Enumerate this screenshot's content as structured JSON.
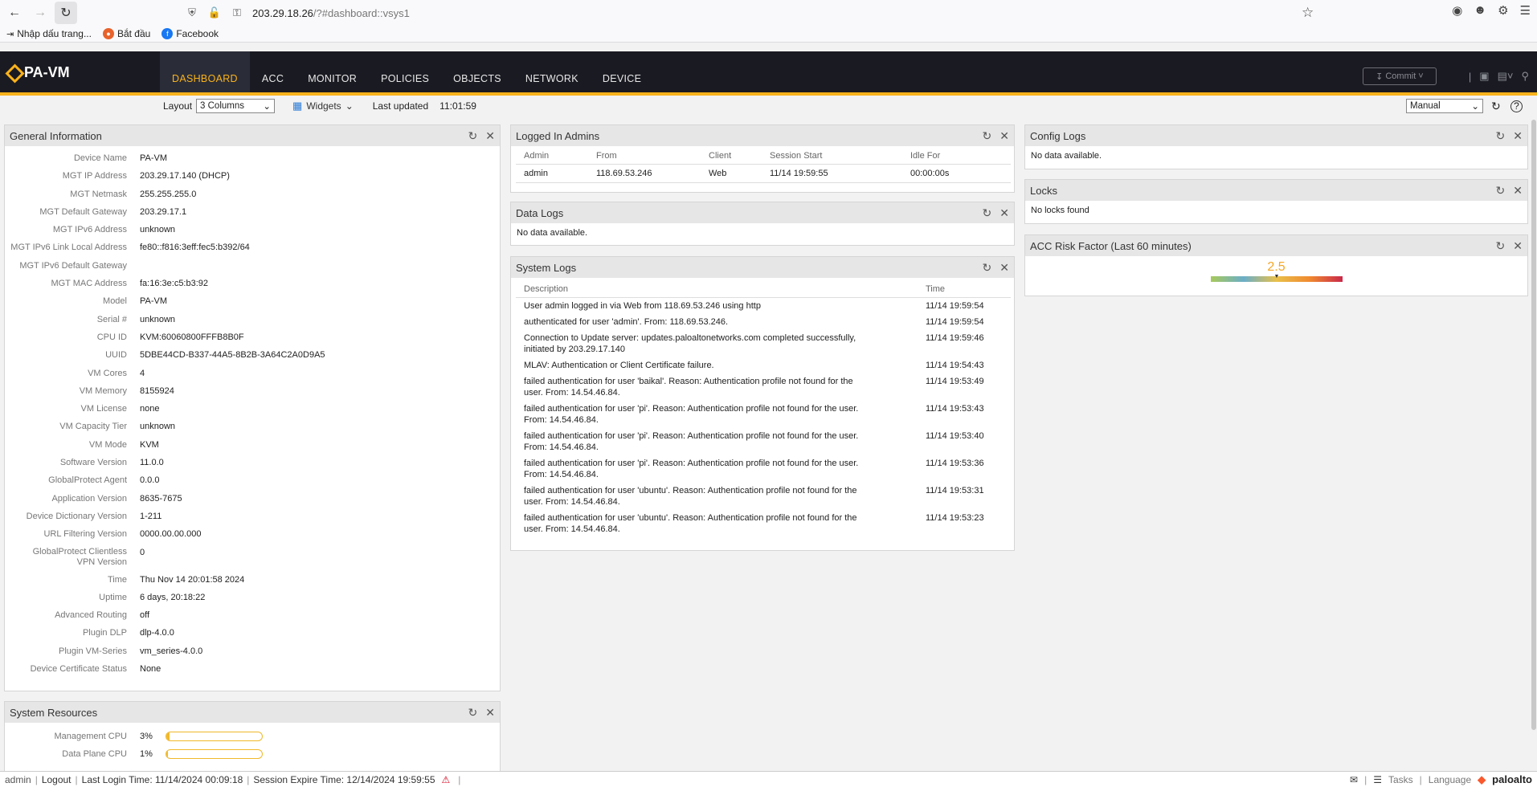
{
  "browser": {
    "url_host": "203.29.18.26",
    "url_path": "/?#dashboard::vsys1",
    "bookmarks": [
      {
        "label": "Nhập dấu trang..."
      },
      {
        "label": "Bắt đầu"
      },
      {
        "label": "Facebook"
      }
    ]
  },
  "app": {
    "logo": "PA-VM",
    "tabs": [
      "DASHBOARD",
      "ACC",
      "MONITOR",
      "POLICIES",
      "OBJECTS",
      "NETWORK",
      "DEVICE"
    ],
    "active_tab": "DASHBOARD",
    "commit_label": "Commit"
  },
  "toolbar": {
    "layout_label": "Layout",
    "layout_value": "3 Columns",
    "widgets_label": "Widgets",
    "last_updated_label": "Last updated",
    "last_updated_value": "11:01:59",
    "refresh_mode": "Manual"
  },
  "general_info": {
    "title": "General Information",
    "rows": [
      {
        "label": "Device Name",
        "value": "PA-VM"
      },
      {
        "label": "MGT IP Address",
        "value": "203.29.17.140 (DHCP)"
      },
      {
        "label": "MGT Netmask",
        "value": "255.255.255.0"
      },
      {
        "label": "MGT Default Gateway",
        "value": "203.29.17.1"
      },
      {
        "label": "MGT IPv6 Address",
        "value": "unknown"
      },
      {
        "label": "MGT IPv6 Link Local Address",
        "value": "fe80::f816:3eff:fec5:b392/64"
      },
      {
        "label": "MGT IPv6 Default Gateway",
        "value": ""
      },
      {
        "label": "MGT MAC Address",
        "value": "fa:16:3e:c5:b3:92"
      },
      {
        "label": "Model",
        "value": "PA-VM"
      },
      {
        "label": "Serial #",
        "value": "unknown"
      },
      {
        "label": "CPU ID",
        "value": "KVM:60060800FFFB8B0F"
      },
      {
        "label": "UUID",
        "value": "5DBE44CD-B337-44A5-8B2B-3A64C2A0D9A5"
      },
      {
        "label": "VM Cores",
        "value": "4"
      },
      {
        "label": "VM Memory",
        "value": "8155924"
      },
      {
        "label": "VM License",
        "value": "none"
      },
      {
        "label": "VM Capacity Tier",
        "value": "unknown"
      },
      {
        "label": "VM Mode",
        "value": "KVM"
      },
      {
        "label": "Software Version",
        "value": "11.0.0"
      },
      {
        "label": "GlobalProtect Agent",
        "value": "0.0.0"
      },
      {
        "label": "Application Version",
        "value": "8635-7675"
      },
      {
        "label": "Device Dictionary Version",
        "value": "1-211"
      },
      {
        "label": "URL Filtering Version",
        "value": "0000.00.00.000"
      },
      {
        "label": "GlobalProtect Clientless VPN Version",
        "value": "0"
      },
      {
        "label": "Time",
        "value": "Thu Nov 14 20:01:58 2024"
      },
      {
        "label": "Uptime",
        "value": "6 days, 20:18:22"
      },
      {
        "label": "Advanced Routing",
        "value": "off"
      },
      {
        "label": "Plugin DLP",
        "value": "dlp-4.0.0"
      },
      {
        "label": "Plugin VM-Series",
        "value": "vm_series-4.0.0"
      },
      {
        "label": "Device Certificate Status",
        "value": "None"
      }
    ]
  },
  "system_resources": {
    "title": "System Resources",
    "rows": [
      {
        "label": "Management CPU",
        "value": "3%",
        "fraction": 0.03
      },
      {
        "label": "Data Plane CPU",
        "value": "1%",
        "fraction": 0.01
      }
    ]
  },
  "logged_in_admins": {
    "title": "Logged In Admins",
    "columns": [
      "Admin",
      "From",
      "Client",
      "Session Start",
      "Idle For"
    ],
    "rows": [
      [
        "admin",
        "118.69.53.246",
        "Web",
        "11/14 19:59:55",
        "00:00:00s"
      ]
    ]
  },
  "data_logs": {
    "title": "Data Logs",
    "message": "No data available."
  },
  "system_logs": {
    "title": "System Logs",
    "columns": [
      "Description",
      "Time"
    ],
    "rows": [
      [
        "User admin logged in via Web from 118.69.53.246 using http",
        "11/14 19:59:54"
      ],
      [
        "authenticated for user 'admin'. From: 118.69.53.246.",
        "11/14 19:59:54"
      ],
      [
        "Connection to Update server: updates.paloaltonetworks.com completed successfully, initiated by 203.29.17.140",
        "11/14 19:59:46"
      ],
      [
        "MLAV: Authentication or Client Certificate failure.",
        "11/14 19:54:43"
      ],
      [
        "failed authentication for user 'baikal'. Reason: Authentication profile not found for the user. From: 14.54.46.84.",
        "11/14 19:53:49"
      ],
      [
        "failed authentication for user 'pi'. Reason: Authentication profile not found for the user. From: 14.54.46.84.",
        "11/14 19:53:43"
      ],
      [
        "failed authentication for user 'pi'. Reason: Authentication profile not found for the user. From: 14.54.46.84.",
        "11/14 19:53:40"
      ],
      [
        "failed authentication for user 'pi'. Reason: Authentication profile not found for the user. From: 14.54.46.84.",
        "11/14 19:53:36"
      ],
      [
        "failed authentication for user 'ubuntu'. Reason: Authentication profile not found for the user. From: 14.54.46.84.",
        "11/14 19:53:31"
      ],
      [
        "failed authentication for user 'ubuntu'. Reason: Authentication profile not found for the user. From: 14.54.46.84.",
        "11/14 19:53:23"
      ]
    ]
  },
  "config_logs": {
    "title": "Config Logs",
    "message": "No data available."
  },
  "locks": {
    "title": "Locks",
    "message": "No locks found"
  },
  "acc_risk": {
    "title": "ACC Risk Factor (Last 60 minutes)",
    "value": "2.5",
    "fraction": 0.5,
    "value_color": "#f5a623"
  },
  "statusbar": {
    "user": "admin",
    "logout": "Logout",
    "last_login": "Last Login Time: 11/14/2024 00:09:18",
    "session_expire": "Session Expire Time: 12/14/2024 19:59:55",
    "tasks": "Tasks",
    "language": "Language",
    "brand": "paloalto"
  },
  "colors": {
    "accent": "#fab21c",
    "nav_bg": "#1a1a22"
  }
}
